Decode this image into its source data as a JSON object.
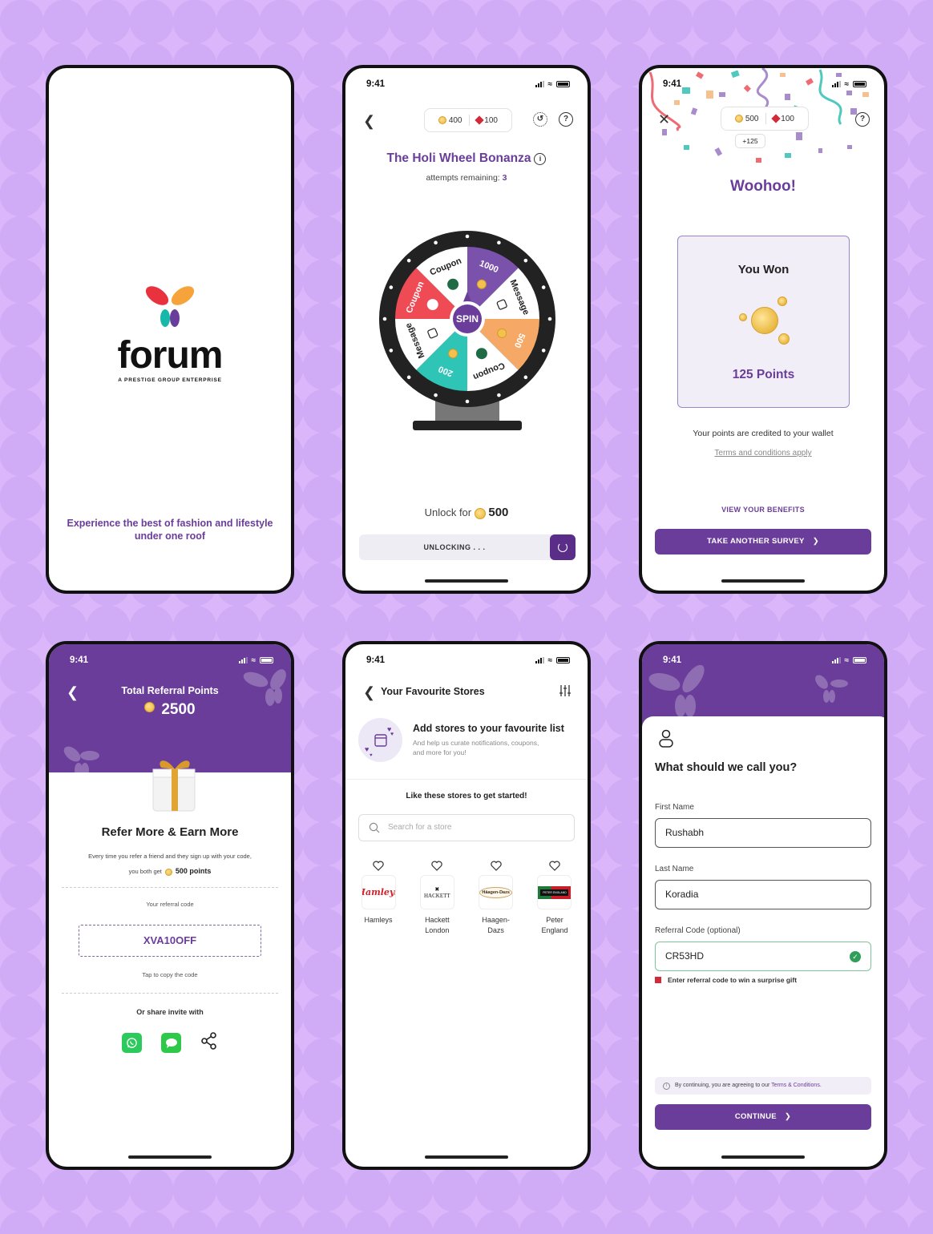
{
  "status_time": "9:41",
  "splash": {
    "brand": "forum",
    "brand_sub": "A PRESTIGE GROUP ENTERPRISE",
    "tagline": "Experience the best of fashion and lifestyle under one roof",
    "colors": {
      "red": "#e8333f",
      "orange": "#f7a33c",
      "teal": "#17b8aa",
      "purple": "#6a3d9a"
    }
  },
  "wheel_screen": {
    "coins": "400",
    "gems": "100",
    "title": "The Holi Wheel Bonanza",
    "attempts_label": "attempts remaining:",
    "attempts_value": "3",
    "center_label": "SPIN",
    "segments": [
      {
        "label": "1000",
        "type": "points",
        "color": "#7b52ab"
      },
      {
        "label": "Message",
        "type": "message",
        "color": "#ffffff"
      },
      {
        "label": "500",
        "type": "points",
        "color": "#f6a866"
      },
      {
        "label": "Coupon",
        "type": "coupon",
        "color": "#ffffff"
      },
      {
        "label": "200",
        "type": "points",
        "color": "#2ec4b6"
      },
      {
        "label": "Message",
        "type": "message",
        "color": "#ffffff"
      },
      {
        "label": "Coupon",
        "type": "coupon",
        "color": "#ef4b55"
      },
      {
        "label": "Coupon",
        "type": "coupon",
        "color": "#ffffff"
      }
    ],
    "unlock_label": "Unlock for",
    "unlock_value": "500",
    "unlocking_label": "UNLOCKING . . ."
  },
  "win_screen": {
    "coins": "500",
    "gems": "100",
    "delta": "+125",
    "title": "Woohoo!",
    "won_label": "You Won",
    "won_points": "125 Points",
    "credited": "Your points are credited to your wallet",
    "terms": "Terms and conditions apply",
    "view_benefits": "VIEW YOUR BENEFITS",
    "cta": "TAKE ANOTHER SURVEY"
  },
  "referral_screen": {
    "header_title": "Total Referral Points",
    "total_points": "2500",
    "heading": "Refer More & Earn More",
    "desc_line1": "Every time you refer a friend and they sign up with your code,",
    "desc_line2": "you both get",
    "desc_points": "500 points",
    "code_label": "Your referral code",
    "code": "XVA10OFF",
    "tap_copy": "Tap to copy the code",
    "share_label": "Or share invite with",
    "share_options": [
      "whatsapp",
      "messages",
      "share"
    ]
  },
  "stores_screen": {
    "title": "Your Favourite Stores",
    "add_title": "Add stores to your favourite list",
    "add_sub": "And help us curate notifications, coupons, and more for you!",
    "like_label": "Like these stores to get started!",
    "search_placeholder": "Search for a store",
    "stores": [
      {
        "name": "Hamleys",
        "logo_text": "Hamleys"
      },
      {
        "name": "Hackett London",
        "logo_text": "HACKETT"
      },
      {
        "name": "Haagen-Dazs",
        "logo_text": "Häagen-Dazs"
      },
      {
        "name": "Peter England",
        "logo_text": "PETER ENGLAND"
      }
    ]
  },
  "name_screen": {
    "heading": "What should we call you?",
    "first_name_label": "First Name",
    "first_name_value": "Rushabh",
    "last_name_label": "Last Name",
    "last_name_value": "Koradia",
    "referral_label": "Referral Code (optional)",
    "referral_value": "CR53HD",
    "hint": "Enter referral code to win a surprise gift",
    "consent_prefix": "By continuing, you are agreeing to our",
    "consent_link": "Terms & Conditions.",
    "cta": "CONTINUE"
  }
}
